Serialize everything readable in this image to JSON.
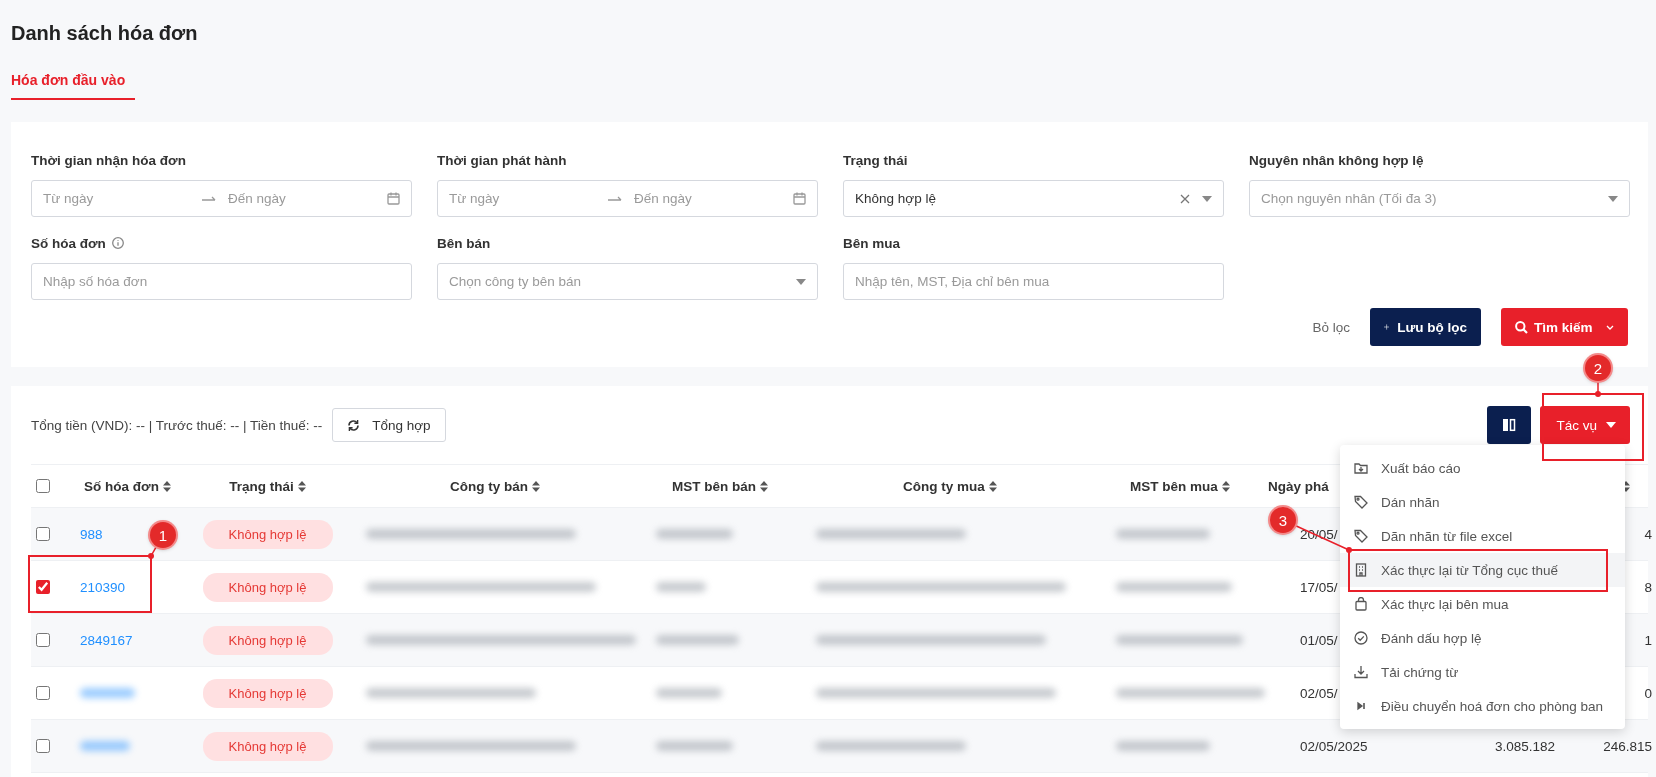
{
  "page": {
    "title": "Danh sách hóa đơn"
  },
  "tabs": [
    {
      "label": "Hóa đơn đầu vào",
      "selected": true
    }
  ],
  "filters": [
    {
      "kind": "daterange",
      "label": "Thời gian nhận hóa đơn",
      "from_placeholder": "Từ ngày",
      "to_placeholder": "Đến ngày"
    },
    {
      "kind": "daterange",
      "label": "Thời gian phát hành",
      "from_placeholder": "Từ ngày",
      "to_placeholder": "Đến ngày"
    },
    {
      "kind": "select",
      "label": "Trạng thái",
      "value": "Không hợp lệ",
      "clearable": true
    },
    {
      "kind": "select",
      "label": "Nguyên nhân không hợp lệ",
      "placeholder": "Chọn nguyên nhân (Tối đa 3)"
    },
    {
      "kind": "text",
      "label": "Số hóa đơn",
      "info": true,
      "placeholder": "Nhập số hóa đơn"
    },
    {
      "kind": "select",
      "label": "Bên bán",
      "placeholder": "Chọn công ty bên bán"
    },
    {
      "kind": "text",
      "label": "Bên mua",
      "placeholder": "Nhập tên, MST, Địa chỉ bên mua"
    }
  ],
  "filter_actions": {
    "clear": "Bỏ lọc",
    "save": "Lưu bộ lọc",
    "search": "Tìm kiếm"
  },
  "summary": {
    "text": "Tổng tiền (VND): -- | Trước thuế: -- | Tiền thuế: --",
    "refresh_button": "Tổng hợp"
  },
  "actions_button": "Tác vụ",
  "actions_menu": [
    {
      "label": "Xuất báo cáo",
      "selected": false
    },
    {
      "label": "Dán nhãn",
      "selected": false
    },
    {
      "label": "Dãn nhãn từ file excel",
      "selected": false
    },
    {
      "label": "Xác thực lại từ Tổng cục thuế",
      "selected": true
    },
    {
      "label": "Xác thực lại bên mua",
      "selected": false
    },
    {
      "label": "Đánh dấu hợp lệ",
      "selected": false
    },
    {
      "label": "Tải chứng từ",
      "selected": false
    },
    {
      "label": "Điều chuyển hoá đơn cho phòng ban",
      "selected": false
    }
  ],
  "table": {
    "all_selected": false,
    "columns": [
      "Số hóa đơn",
      "Trạng thái",
      "Công ty bán",
      "MST bên bán",
      "Công ty mua",
      "MST bên mua",
      "Ngày phá"
    ],
    "rows": [
      {
        "selected": false,
        "number": "988",
        "status": "Không hợp lệ",
        "date": "20/05/",
        "column_last": "4"
      },
      {
        "selected": true,
        "number": "210390",
        "status": "Không hợp lệ",
        "date": "17/05/",
        "column_last": "8"
      },
      {
        "selected": false,
        "number": "2849167",
        "status": "Không hợp lệ",
        "date": "01/05/",
        "column_last": "1"
      },
      {
        "selected": false,
        "status": "Không hợp lệ",
        "date": "02/05/",
        "column_last": "0"
      },
      {
        "selected": false,
        "status": "Không hợp lệ",
        "date": "02/05/2025",
        "amount": "3.085.182",
        "column_last": "246.815"
      }
    ]
  },
  "annotations": [
    {
      "label": "1"
    },
    {
      "label": "2"
    },
    {
      "label": "3"
    }
  ]
}
